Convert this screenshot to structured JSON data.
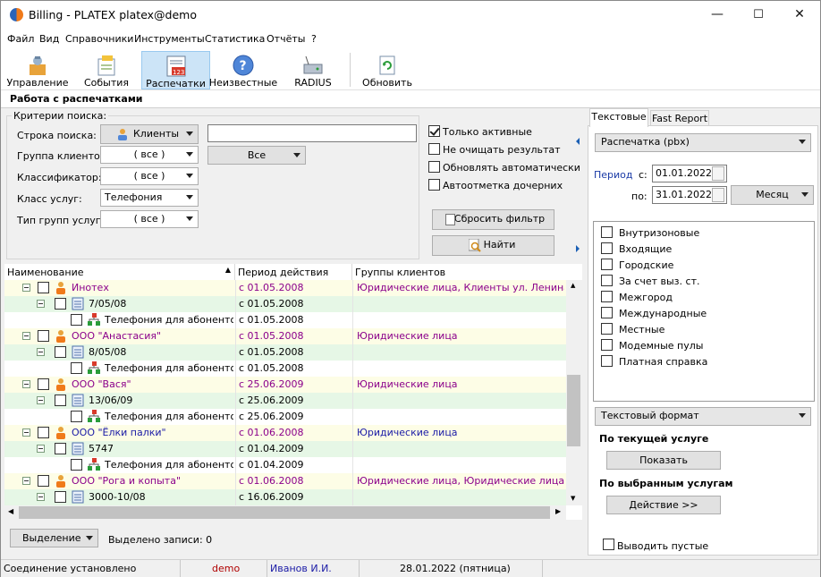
{
  "window": {
    "title": "Billing - PLATEX platex@demo",
    "minimize": "—",
    "maximize": "☐",
    "close": "✕"
  },
  "menu": [
    "Файл",
    "Вид",
    "Справочники",
    "Инструменты",
    "Статистика",
    "Отчёты",
    "?"
  ],
  "toolbar": [
    {
      "label": "Управление",
      "icon": "management-icon"
    },
    {
      "label": "События",
      "icon": "events-icon"
    },
    {
      "label": "Распечатки",
      "icon": "printouts-icon",
      "active": true
    },
    {
      "label": "Неизвестные",
      "icon": "unknown-icon"
    },
    {
      "label": "RADIUS",
      "icon": "radius-icon"
    },
    {
      "label": "Обновить",
      "icon": "refresh-icon"
    }
  ],
  "section_title": "Работа с распечатками",
  "criteria": {
    "legend": "Критерии поиска:",
    "search_label": "Строка поиска:",
    "search_mode": "Клиенты",
    "search_value": "",
    "client_group_label": "Группа клиентов:",
    "client_group_value": "( все )",
    "client_group_value2": "Все",
    "classifier_label": "Классификатор:",
    "classifier_value": "( все )",
    "service_class_label": "Класс услуг:",
    "service_class_value": "Телефония",
    "service_group_type_label": "Тип групп услуг:",
    "service_group_type_value": "( все )",
    "only_active": "Только активные",
    "no_clear": "Не очищать результат",
    "auto_update": "Обновлять автоматически",
    "auto_mark": "Автоотметка дочерних",
    "reset_filter": "Сбросить фильтр",
    "find": "Найти"
  },
  "grid": {
    "columns": [
      "Наименование",
      "Период действия",
      "Группы клиентов"
    ],
    "rows": [
      {
        "level": 0,
        "name": "Инотех",
        "period": "с 01.05.2008",
        "groups": "Юридические лица, Клиенты ул. Ленина"
      },
      {
        "level": 1,
        "name": "7/05/08",
        "period": "с 01.05.2008",
        "groups": ""
      },
      {
        "level": 2,
        "name": "Телефония для абонентов",
        "period": "с 01.05.2008",
        "groups": ""
      },
      {
        "level": 0,
        "name": "ООО \"Анастасия\"",
        "period": "с 01.05.2008",
        "groups": "Юридические лица"
      },
      {
        "level": 1,
        "name": "8/05/08",
        "period": "с 01.05.2008",
        "groups": ""
      },
      {
        "level": 2,
        "name": "Телефония для абонентов",
        "period": "с 01.05.2008",
        "groups": ""
      },
      {
        "level": 0,
        "name": "ООО \"Вася\"",
        "period": "с 25.06.2009",
        "groups": "Юридические лица"
      },
      {
        "level": 1,
        "name": "13/06/09",
        "period": "с 25.06.2009",
        "groups": ""
      },
      {
        "level": 2,
        "name": "Телефония для абонентов",
        "period": "с 25.06.2009",
        "groups": ""
      },
      {
        "level": 0,
        "name": "ООО \"Ёлки палки\"",
        "period": "с 01.06.2008",
        "groups": "Юридические лица",
        "blue": true
      },
      {
        "level": 1,
        "name": "5747",
        "period": "с 01.04.2009",
        "groups": ""
      },
      {
        "level": 2,
        "name": "Телефония для абонентов",
        "period": "с 01.04.2009",
        "groups": ""
      },
      {
        "level": 0,
        "name": "ООО \"Рога и копыта\"",
        "period": "с 01.06.2008",
        "groups": "Юридические лица, Юридические лица"
      },
      {
        "level": 1,
        "name": "3000-10/08",
        "period": "с 16.06.2009",
        "groups": ""
      }
    ]
  },
  "bottom": {
    "selection_label": "Выделение",
    "selected_text": "Выделено  записи: 0"
  },
  "right": {
    "tabs": [
      "Текстовые",
      "Fast Report"
    ],
    "printout_type": "Распечатка (pbx)",
    "period_label": "Период",
    "from_label": "с:",
    "from_date": "01.01.2022",
    "to_label": "по:",
    "to_date": "31.01.2022",
    "period_unit": "Месяц",
    "call_types": [
      "Внутризоновые",
      "Входящие",
      "Городские",
      "За счет выз. ст.",
      "Межгород",
      "Международные",
      "Местные",
      "Модемные пулы",
      "Платная справка"
    ],
    "format": "Текстовый формат",
    "by_current": "По текущей услуге",
    "show_btn": "Показать",
    "by_selected": "По выбранным услугам",
    "action_btn": "Действие >>",
    "output_empty": "Выводить пустые"
  },
  "status": {
    "connection": "Соединение установлено",
    "db": "demo",
    "user": "Иванов И.И.",
    "date": "28.01.2022 (пятница)"
  }
}
